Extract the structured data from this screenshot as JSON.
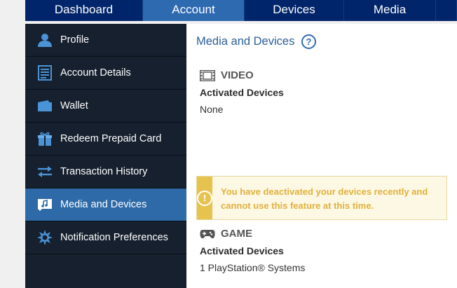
{
  "topnav": {
    "tabs": [
      {
        "label": "Dashboard"
      },
      {
        "label": "Account",
        "active": true
      },
      {
        "label": "Devices"
      },
      {
        "label": "Media"
      }
    ]
  },
  "sidebar": {
    "items": [
      {
        "label": "Profile",
        "icon": "user-icon"
      },
      {
        "label": "Account Details",
        "icon": "document-icon"
      },
      {
        "label": "Wallet",
        "icon": "wallet-icon"
      },
      {
        "label": "Redeem Prepaid Card",
        "icon": "gift-icon"
      },
      {
        "label": "Transaction History",
        "icon": "transfer-arrows-icon"
      },
      {
        "label": "Media and Devices",
        "icon": "media-devices-icon",
        "active": true
      },
      {
        "label": "Notification Preferences",
        "icon": "gear-burst-icon"
      }
    ]
  },
  "main": {
    "title": "Media and Devices",
    "help_glyph": "?",
    "video": {
      "heading": "VIDEO",
      "activated_label": "Activated Devices",
      "activated_value": "None"
    },
    "warning": {
      "glyph": "!",
      "message": "You have deactivated your devices recently and cannot use this feature at this time."
    },
    "game": {
      "heading": "GAME",
      "activated_label": "Activated Devices",
      "activated_value": "1 PlayStation® Systems"
    }
  },
  "colors": {
    "nav_bg": "#00256a",
    "nav_active": "#2e6ab0",
    "sidebar_bg": "#16202e",
    "sidebar_active": "#2d6aa7",
    "sidebar_icon": "#4a93d6",
    "title_blue": "#2b5e97",
    "warning_bar": "#e6c34f",
    "warning_text": "#e0b13f"
  }
}
